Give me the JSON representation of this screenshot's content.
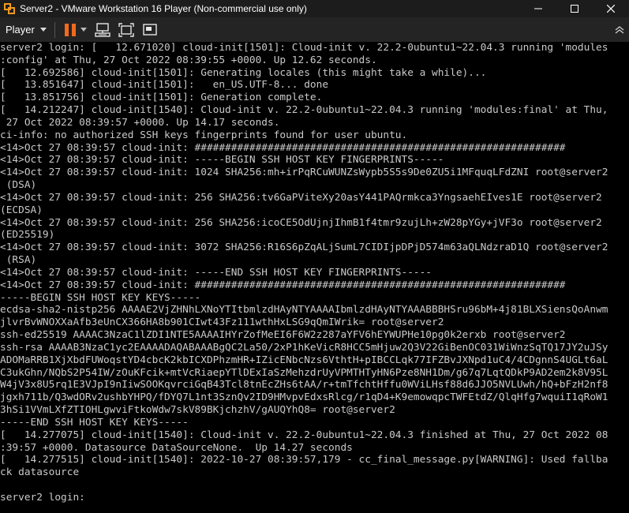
{
  "window": {
    "title": "Server2 - VMware Workstation 16 Player (Non-commercial use only)",
    "icon": "vmware-icon",
    "controls": [
      "minimize-icon",
      "maximize-icon",
      "close-icon"
    ]
  },
  "toolbar": {
    "player_label": "Player",
    "icons": [
      "chevron-down-icon",
      "pause-icon",
      "send-ctrl-alt-del-icon",
      "fit-guest-icon",
      "unity-icon",
      "collapse-toolbar-icon"
    ],
    "accent_color": "#f06a1d"
  },
  "console": {
    "lines": [
      "server2 login: [   12.671020] cloud-init[1501]: Cloud-init v. 22.2-0ubuntu1~22.04.3 running 'modules",
      ":config' at Thu, 27 Oct 2022 08:39:55 +0000. Up 12.62 seconds.",
      "[   12.692586] cloud-init[1501]: Generating locales (this might take a while)...",
      "[   13.851647] cloud-init[1501]:   en_US.UTF-8... done",
      "[   13.851756] cloud-init[1501]: Generation complete.",
      "[   14.212247] cloud-init[1540]: Cloud-init v. 22.2-0ubuntu1~22.04.3 running 'modules:final' at Thu,",
      " 27 Oct 2022 08:39:57 +0000. Up 14.17 seconds.",
      "ci-info: no authorized SSH keys fingerprints found for user ubuntu.",
      "<14>Oct 27 08:39:57 cloud-init: #############################################################",
      "<14>Oct 27 08:39:57 cloud-init: -----BEGIN SSH HOST KEY FINGERPRINTS-----",
      "<14>Oct 27 08:39:57 cloud-init: 1024 SHA256:mh+irPqRCuWUNZsWypb5S5s9De0ZU5i1MFquqLFdZNI root@server2",
      " (DSA)",
      "<14>Oct 27 08:39:57 cloud-init: 256 SHA256:tv6GaPViteXy20asY441PAQrmkca3YngsaehEIves1E root@server2",
      "(ECDSA)",
      "<14>Oct 27 08:39:57 cloud-init: 256 SHA256:icoCE5OdUjnjIhmB1f4tmr9zujLh+zW28pYGy+jVF3o root@server2",
      "(ED25519)",
      "<14>Oct 27 08:39:57 cloud-init: 3072 SHA256:R16S6pZqALjSumL7CIDIjpDPjD574m63aQLNdzraD1Q root@server2",
      " (RSA)",
      "<14>Oct 27 08:39:57 cloud-init: -----END SSH HOST KEY FINGERPRINTS-----",
      "<14>Oct 27 08:39:57 cloud-init: #############################################################",
      "-----BEGIN SSH HOST KEY KEYS-----",
      "ecdsa-sha2-nistp256 AAAAE2VjZHNhLXNoYTItbmlzdHAyNTYAAAAIbmlzdHAyNTYAAABBBHSru96bM+4j81BLXSiensQoAnwm",
      "jlvrBvWNOXXaAfb3eUnCX366HA8b901CIwt43Fz111wthHxLSG9qQmIWrik= root@server2",
      "ssh-ed25519 AAAAC3NzaC1lZDI1NTE5AAAAIHYrZofMeEI6F6W2z287aYFV6hEYWUPHe10pg0k2erxb root@server2",
      "ssh-rsa AAAAB3NzaC1yc2EAAAADAQABAAABgQC2La50/2xP1hKeVicR8HCC5mHjuw2Q3V22GiBenOC031WiWnzSqTQ17JY2uJSy",
      "ADOMaRRB1XjXbdFUWoqstYD4cbcK2kbICXDPhzmHR+IZicENbcNzs6VthtH+pIBCCLqk77IFZBvJXNpd1uC4/4CDgnnS4UGLt6aL",
      "C3ukGhn/NQbS2P54IW/zOuKFcik+mtVcRiaepYTlDExIaSzMehzdrUyVPMTHTyHN6Pze8NH1Dm/g67q7LqtQDkP9AD2em2k8V95L",
      "W4jV3x8U5rq1E3VJpI9nIiwSOOKqvrciGqB43Tcl8tnEcZHs6tAA/r+tmTfchtHffu0WViLHsf88d6JJO5NVLUwh/hQ+bFzH2nf8",
      "jgxh711b/Q3wdORv2ushbYHPQ/fDYQ7L1nt3SznQv2ID9HMvpvEdxsRlcg/r1qD4+K9emowqpcTWFEtdZ/QlqHfg7wquiI1qRoW1",
      "3hSi1VVmLXfZTIOHLgwviFtkoWdw7skV89BKjchzhV/gAUQYhQ8= root@server2",
      "-----END SSH HOST KEY KEYS-----",
      "[   14.277075] cloud-init[1540]: Cloud-init v. 22.2-0ubuntu1~22.04.3 finished at Thu, 27 Oct 2022 08",
      ":39:57 +0000. Datasource DataSourceNone.  Up 14.27 seconds",
      "[   14.277515] cloud-init[1540]: 2022-10-27 08:39:57,179 - cc_final_message.py[WARNING]: Used fallba",
      "ck datasource",
      "",
      "server2 login:"
    ]
  }
}
